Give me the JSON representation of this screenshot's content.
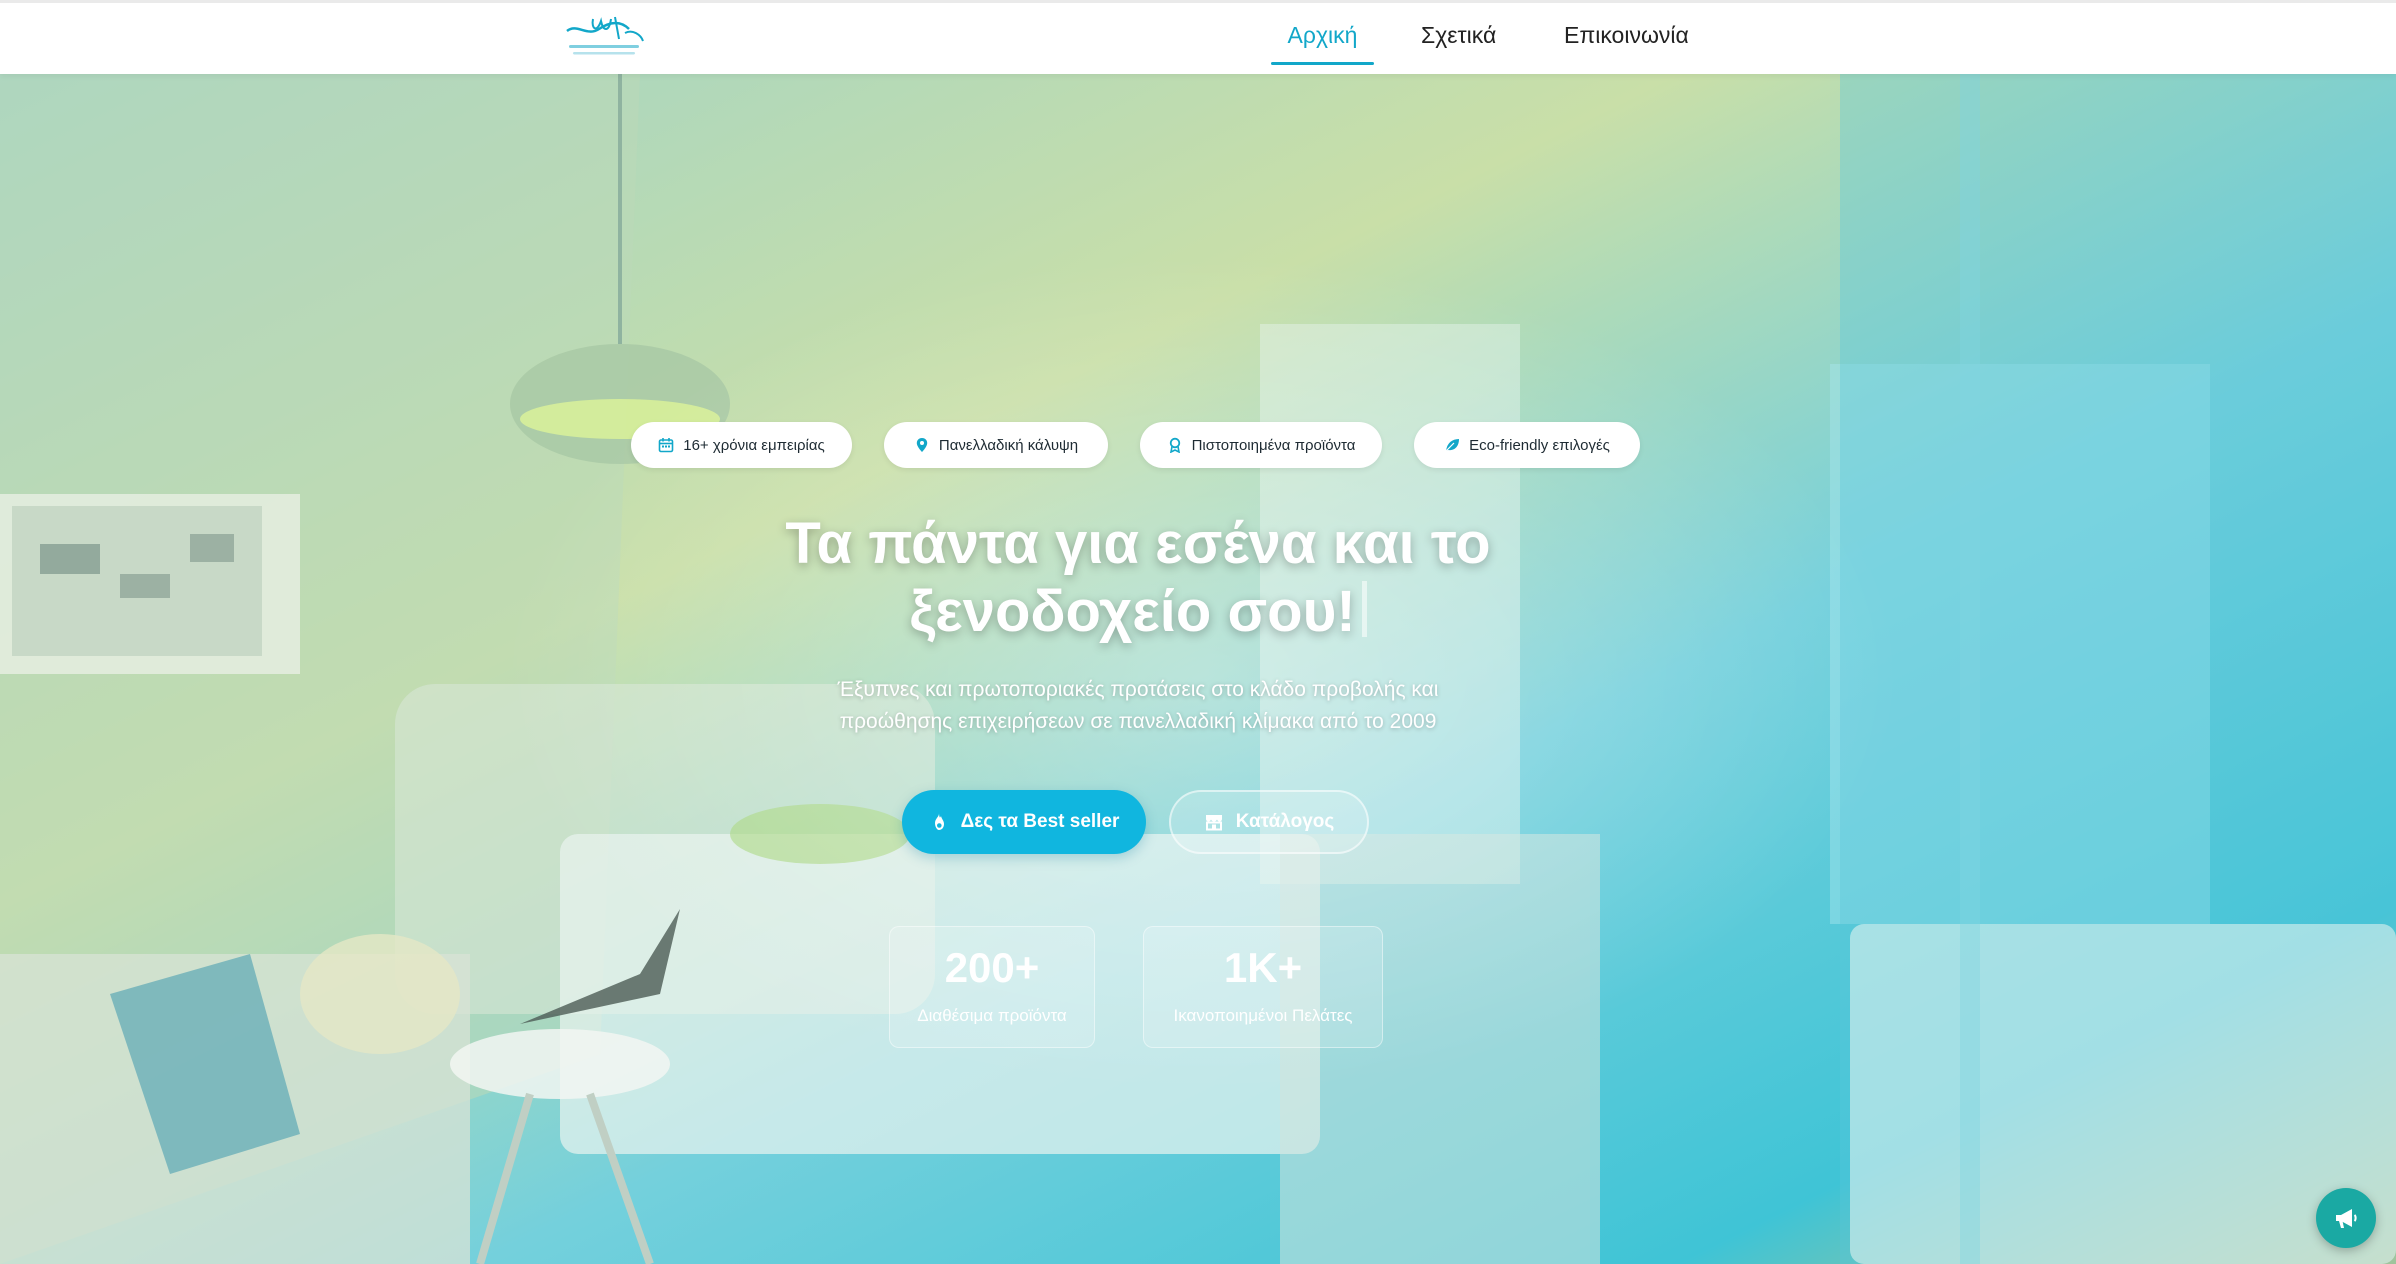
{
  "colors": {
    "accent": "#12a7c9",
    "button_primary": "#10b6df",
    "fab": "#1aa9a3",
    "badge_icon": "#12a7c9"
  },
  "nav": {
    "logo_icon": "brand-logo",
    "items": [
      {
        "label": "Αρχική",
        "active": true
      },
      {
        "label": "Σχετικά",
        "active": false
      },
      {
        "label": "Επικοινωνία",
        "active": false
      }
    ]
  },
  "hero": {
    "badges": [
      {
        "icon": "calendar-icon",
        "label": "16+ χρόνια εμπειρίας"
      },
      {
        "icon": "map-pin-icon",
        "label": "Πανελλαδική κάλυψη"
      },
      {
        "icon": "award-icon",
        "label": "Πιστοποιημένα προϊόντα"
      },
      {
        "icon": "leaf-icon",
        "label": "Eco-friendly επιλογές"
      }
    ],
    "title_line1": "Τα πάντα για εσένα και το",
    "title_line2": "ξενοδοχείο σου!",
    "subtitle_line1": "Έξυπνες και πρωτοποριακές προτάσεις στο κλάδο προβολής και",
    "subtitle_line2": "προώθησης επιχειρήσεων σε πανελλαδική κλίμακα από το 2009",
    "buttons": {
      "primary": {
        "icon": "fire-icon",
        "label": "Δες τα Best seller"
      },
      "secondary": {
        "icon": "store-icon",
        "label": "Κατάλογος"
      }
    },
    "stats": [
      {
        "value": "200+",
        "label": "Διαθέσιμα προϊόντα"
      },
      {
        "value": "1K+",
        "label": "Ικανοποιημένοι Πελάτες"
      }
    ]
  },
  "fab": {
    "icon": "megaphone-icon"
  }
}
